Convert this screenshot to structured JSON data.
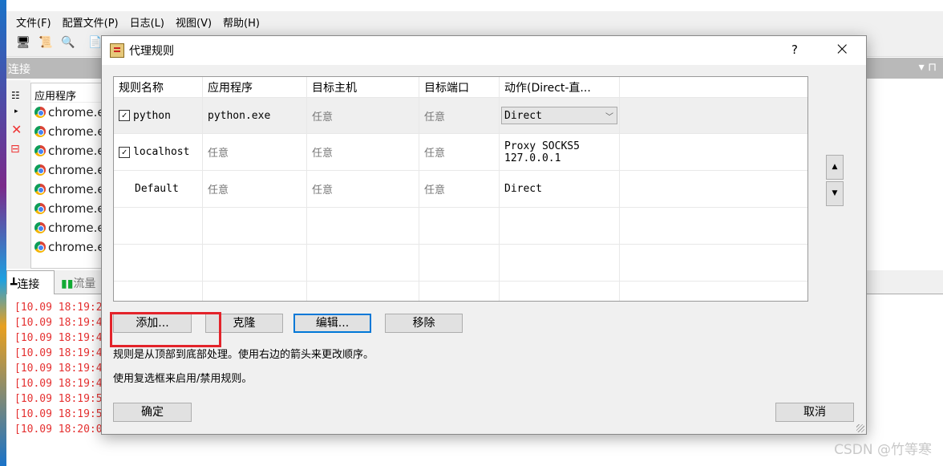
{
  "app": {
    "menu": [
      "文件(F)",
      "配置文件(P)",
      "日志(L)",
      "视图(V)",
      "帮助(H)"
    ],
    "panel_title": "连接",
    "list_header": "应用程序",
    "list_items": [
      "chrome.e",
      "chrome.e",
      "chrome.e",
      "chrome.e",
      "chrome.e",
      "chrome.e",
      "chrome.e",
      "chrome.e"
    ],
    "tabs": [
      "连接",
      "流量"
    ],
    "log_lines": [
      "[10.09 18:19:2",
      "[10.09 18:19:4",
      "[10.09 18:19:4",
      "[10.09 18:19:4",
      "[10.09 18:19:4",
      "[10.09 18:19:4",
      "[10.09 18:19:5",
      "[10.09 18:19:5",
      "[10.09 18:20:0"
    ]
  },
  "dialog": {
    "title": "代理规则",
    "help": "?",
    "close": "×",
    "columns": [
      "规则名称",
      "应用程序",
      "目标主机",
      "目标端口",
      "动作(Direct-直..."
    ],
    "rows": [
      {
        "name": "python",
        "checked": true,
        "app": "python.exe",
        "host": "任意",
        "port": "任意",
        "action": "Direct"
      },
      {
        "name": "localhost",
        "checked": true,
        "app": "任意",
        "host": "任意",
        "port": "任意",
        "action": "Proxy SOCKS5",
        "action2": "127.0.0.1"
      },
      {
        "name": "Default",
        "checked": false,
        "app": "任意",
        "host": "任意",
        "port": "任意",
        "action": "Direct"
      }
    ],
    "buttons": {
      "add": "添加...",
      "clone": "克隆",
      "edit": "编辑...",
      "remove": "移除",
      "ok": "确定",
      "cancel": "取消",
      "up": "▲",
      "down": "▼"
    },
    "hint1": "规则是从顶部到底部处理。使用右边的箭头来更改顺序。",
    "hint2": "使用复选框来启用/禁用规则。"
  },
  "watermark": "CSDN @竹等寒"
}
